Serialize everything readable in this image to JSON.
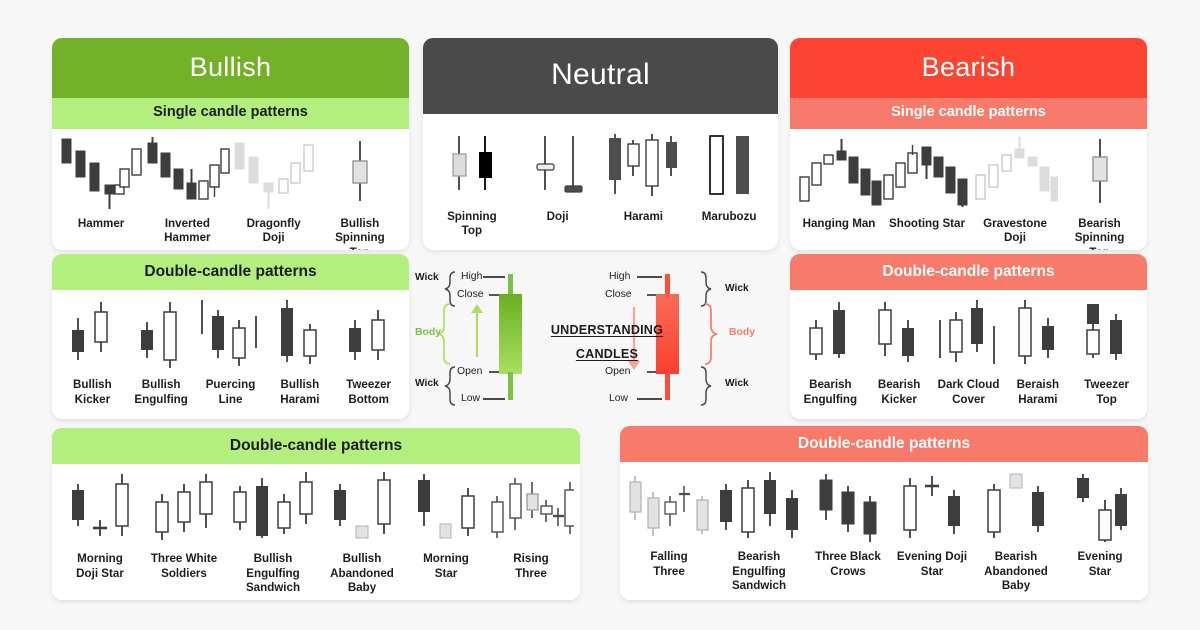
{
  "page": {
    "background": "#f7f7f7",
    "colors": {
      "bullish_header": "#72b128",
      "bullish_subheader": "#b3ef7e",
      "neutral_header": "#4a4a4a",
      "bearish_header": "#fc4433",
      "bearish_subheader": "#f87a6b",
      "candle_dark": "#3d3d3d",
      "candle_hollow_border": "#3d3d3d",
      "candle_faded": "#d9d9d9",
      "green_candle": "#7cc242",
      "red_candle": "#fb4f3c"
    }
  },
  "bullish": {
    "title": "Bullish",
    "single": {
      "header": "Single candle patterns",
      "patterns": [
        {
          "label": "Hammer"
        },
        {
          "label": "Inverted\nHammer"
        },
        {
          "label": "Dragonfly\nDoji"
        },
        {
          "label": "Bullish\nSpinning\nTop"
        }
      ]
    },
    "double": {
      "header": "Double-candle patterns",
      "patterns": [
        {
          "label": "Bullish\nKicker"
        },
        {
          "label": "Bullish\nEngulfing"
        },
        {
          "label": "Puercing\nLine"
        },
        {
          "label": "Bullish\nHarami"
        },
        {
          "label": "Tweezer\nBottom"
        }
      ]
    },
    "triple": {
      "header": "Double-candle patterns",
      "patterns": [
        {
          "label": "Morning\nDoji Star"
        },
        {
          "label": "Three White\nSoldiers"
        },
        {
          "label": "Bullish\nEngulfing Sandwich"
        },
        {
          "label": "Bullish\nAbandoned Baby"
        },
        {
          "label": "Morning\nStar"
        },
        {
          "label": "Rising\nThree"
        }
      ]
    }
  },
  "neutral": {
    "title": "Neutral",
    "patterns": [
      {
        "label": "Spinning\nTop"
      },
      {
        "label": "Doji"
      },
      {
        "label": "Harami"
      },
      {
        "label": "Marubozu"
      }
    ]
  },
  "bearish": {
    "title": "Bearish",
    "single": {
      "header": "Single candle patterns",
      "patterns": [
        {
          "label": "Hanging Man"
        },
        {
          "label": "Shooting Star"
        },
        {
          "label": "Gravestone\nDoji"
        },
        {
          "label": "Bearish\nSpinning\nTop"
        }
      ]
    },
    "double": {
      "header": "Double-candle patterns",
      "patterns": [
        {
          "label": "Bearish\nEngulfing"
        },
        {
          "label": "Bearish\nKicker"
        },
        {
          "label": "Dark Cloud\nCover"
        },
        {
          "label": "Beraish\nHarami"
        },
        {
          "label": "Tweezer\nTop"
        }
      ]
    },
    "triple": {
      "header": "Double-candle patterns",
      "patterns": [
        {
          "label": "Falling\nThree"
        },
        {
          "label": "Bearish\nEngulfing Sandwich"
        },
        {
          "label": "Three Black\nCrows"
        },
        {
          "label": "Evening Doji\nStar"
        },
        {
          "label": "Bearish\nAbandoned Baby"
        },
        {
          "label": "Evening\nStar"
        }
      ]
    }
  },
  "understanding": {
    "title_line1": "UNDERSTANDING",
    "title_line2": "CANDLES",
    "green": {
      "wick_top": "Wick",
      "high": "High",
      "close": "Close",
      "body": "Body",
      "open": "Open",
      "low": "Low",
      "wick_bottom": "Wick"
    },
    "red": {
      "wick_top": "Wick",
      "high": "High",
      "close": "Close",
      "body": "Body",
      "open": "Open",
      "low": "Low",
      "wick_bottom": "Wick"
    }
  }
}
